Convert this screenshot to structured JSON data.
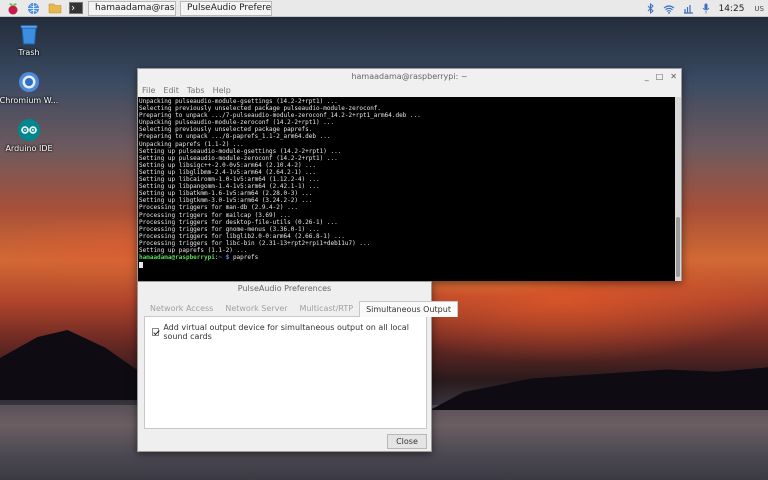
{
  "taskbar": {
    "menu_icon": "raspberry-icon",
    "launchers": [
      "globe-icon",
      "folder-icon",
      "terminal-icon"
    ],
    "tasks": [
      {
        "label": "hamaadama@raspb...",
        "icon": "terminal-icon"
      },
      {
        "label": "PulseAudio Preference...",
        "icon": "window-icon"
      }
    ],
    "tray": [
      "bluetooth-icon",
      "wifi-icon",
      "network-icon",
      "microphone-icon"
    ],
    "clock": "14:25",
    "lang": "US"
  },
  "desktop": {
    "icons": [
      {
        "label": "Trash",
        "icon": "trash-icon"
      },
      {
        "label": "Chromium W...",
        "icon": "chromium-icon"
      },
      {
        "label": "Arduino IDE",
        "icon": "arduino-icon"
      }
    ]
  },
  "terminal": {
    "title": "hamaadama@raspberrypi: ~",
    "menu": [
      "File",
      "Edit",
      "Tabs",
      "Help"
    ],
    "lines": [
      "Unpacking pulseaudio-module-gsettings (14.2-2+rpt1) ...",
      "Selecting previously unselected package pulseaudio-module-zeroconf.",
      "Preparing to unpack .../7-pulseaudio-module-zeroconf_14.2-2+rpt1_arm64.deb ...",
      "Unpacking pulseaudio-module-zeroconf (14.2-2+rpt1) ...",
      "Selecting previously unselected package paprefs.",
      "Preparing to unpack .../8-paprefs_1.1-2_arm64.deb ...",
      "Unpacking paprefs (1.1-2) ...",
      "Setting up pulseaudio-module-gsettings (14.2-2+rpt1) ...",
      "Setting up pulseaudio-module-zeroconf (14.2-2+rpt1) ...",
      "Setting up libsigc++-2.0-0v5:arm64 (2.10.4-2) ...",
      "Setting up libglibmm-2.4-1v5:arm64 (2.64.2-1) ...",
      "Setting up libcairomm-1.0-1v5:arm64 (1.12.2-4) ...",
      "Setting up libpangomm-1.4-1v5:arm64 (2.42.1-1) ...",
      "Setting up libatkmm-1.6-1v5:arm64 (2.28.0-3) ...",
      "Setting up libgtkmm-3.0-1v5:arm64 (3.24.2-2) ...",
      "Processing triggers for man-db (2.9.4-2) ...",
      "Processing triggers for mailcap (3.69) ...",
      "Processing triggers for desktop-file-utils (0.26-1) ...",
      "Processing triggers for gnome-menus (3.36.0-1) ...",
      "Processing triggers for libglib2.0-0:arm64 (2.66.8-1) ...",
      "Processing triggers for libc-bin (2.31-13+rpt2+rpi1+deb11u7) ...",
      "Setting up paprefs (1.1-2) ..."
    ],
    "prompt_user": "hamaadama@raspberrypi",
    "prompt_sep": ":",
    "prompt_path": "~ $",
    "prompt_cmd": " paprefs"
  },
  "pulseaudio": {
    "title": "PulseAudio Preferences",
    "tabs": [
      "Network Access",
      "Network Server",
      "Multicast/RTP",
      "Simultaneous Output"
    ],
    "active_tab": 3,
    "checkbox_label": "Add virtual output device for simultaneous output on all local sound cards",
    "checkbox_checked": true,
    "close_label": "Close"
  }
}
